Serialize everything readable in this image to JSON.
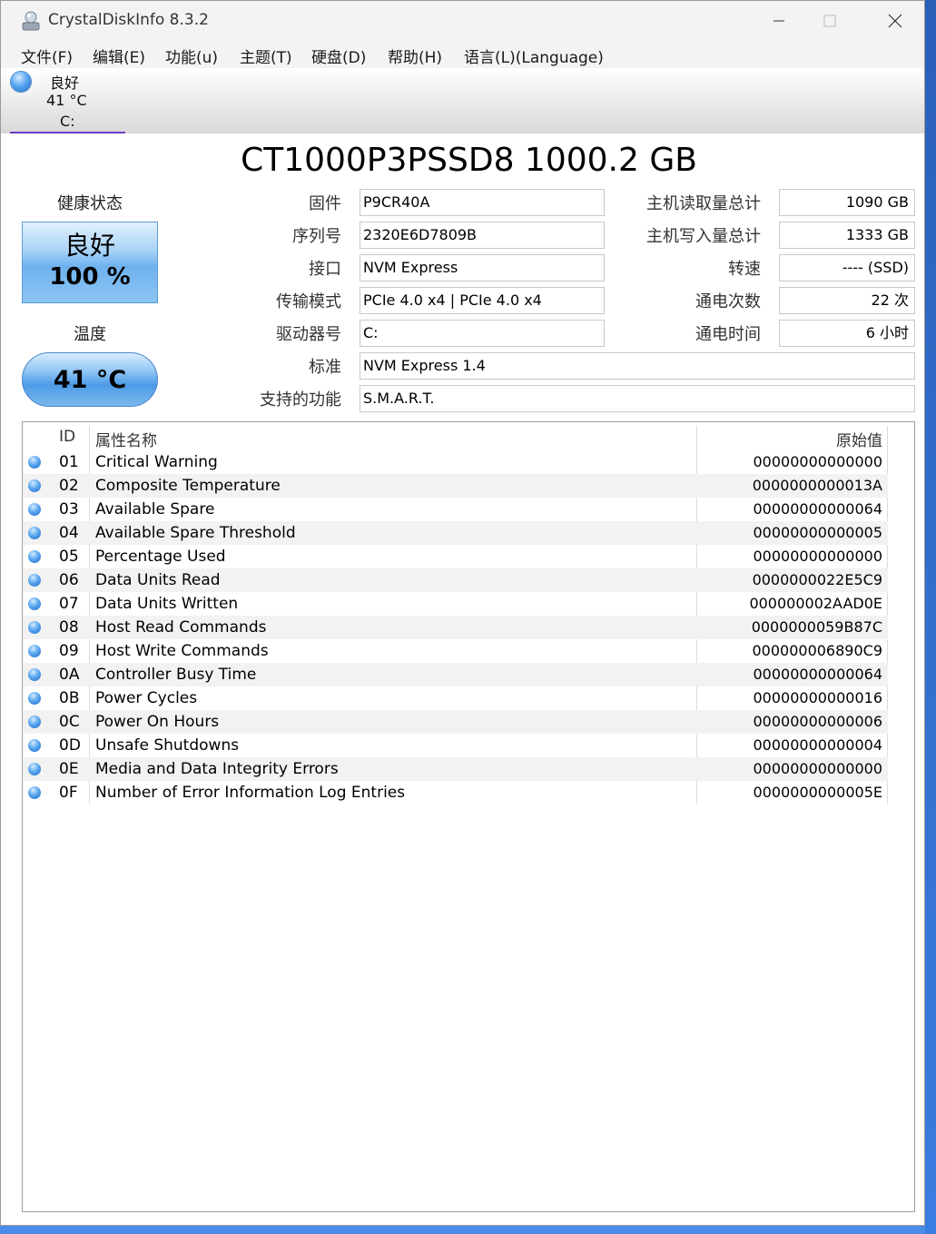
{
  "window": {
    "title": "CrystalDiskInfo 8.3.2"
  },
  "menu": [
    "文件(F)",
    "编辑(E)",
    "功能(u)",
    "主题(T)",
    "硬盘(D)",
    "帮助(H)",
    "语言(L)(Language)"
  ],
  "drive_tab": {
    "status": "良好",
    "temp": "41 °C",
    "letter": "C:"
  },
  "model": "CT1000P3PSSD8 1000.2 GB",
  "health": {
    "label": "健康状态",
    "status": "良好",
    "percent": "100 %"
  },
  "temperature": {
    "label": "温度",
    "value": "41 °C"
  },
  "info": {
    "firmware": {
      "label": "固件",
      "value": "P9CR40A"
    },
    "serial": {
      "label": "序列号",
      "value": "2320E6D7809B"
    },
    "interface": {
      "label": "接口",
      "value": "NVM Express"
    },
    "transfer": {
      "label": "传输模式",
      "value": "PCIe 4.0 x4 | PCIe 4.0 x4"
    },
    "drive_letter": {
      "label": "驱动器号",
      "value": "C:"
    },
    "standard": {
      "label": "标准",
      "value": "NVM Express 1.4"
    },
    "features": {
      "label": "支持的功能",
      "value": "S.M.A.R.T."
    },
    "host_reads": {
      "label": "主机读取量总计",
      "value": "1090 GB"
    },
    "host_writes": {
      "label": "主机写入量总计",
      "value": "1333 GB"
    },
    "rotation": {
      "label": "转速",
      "value": "---- (SSD)"
    },
    "power_count": {
      "label": "通电次数",
      "value": "22 次"
    },
    "power_hours": {
      "label": "通电时间",
      "value": "6 小时"
    }
  },
  "smart": {
    "headers": {
      "id": "ID",
      "name": "属性名称",
      "raw": "原始值"
    },
    "rows": [
      {
        "id": "01",
        "name": "Critical Warning",
        "raw": "00000000000000"
      },
      {
        "id": "02",
        "name": "Composite Temperature",
        "raw": "0000000000013A"
      },
      {
        "id": "03",
        "name": "Available Spare",
        "raw": "00000000000064"
      },
      {
        "id": "04",
        "name": "Available Spare Threshold",
        "raw": "00000000000005"
      },
      {
        "id": "05",
        "name": "Percentage Used",
        "raw": "00000000000000"
      },
      {
        "id": "06",
        "name": "Data Units Read",
        "raw": "0000000022E5C9"
      },
      {
        "id": "07",
        "name": "Data Units Written",
        "raw": "000000002AAD0E"
      },
      {
        "id": "08",
        "name": "Host Read Commands",
        "raw": "0000000059B87C"
      },
      {
        "id": "09",
        "name": "Host Write Commands",
        "raw": "000000006890C9"
      },
      {
        "id": "0A",
        "name": "Controller Busy Time",
        "raw": "00000000000064"
      },
      {
        "id": "0B",
        "name": "Power Cycles",
        "raw": "00000000000016"
      },
      {
        "id": "0C",
        "name": "Power On Hours",
        "raw": "00000000000006"
      },
      {
        "id": "0D",
        "name": "Unsafe Shutdowns",
        "raw": "00000000000004"
      },
      {
        "id": "0E",
        "name": "Media and Data Integrity Errors",
        "raw": "00000000000000"
      },
      {
        "id": "0F",
        "name": "Number of Error Information Log Entries",
        "raw": "0000000000005E"
      }
    ]
  },
  "colors": {
    "good_blue": "#5aa8f0",
    "tab_underline": "#6b3fc7"
  }
}
